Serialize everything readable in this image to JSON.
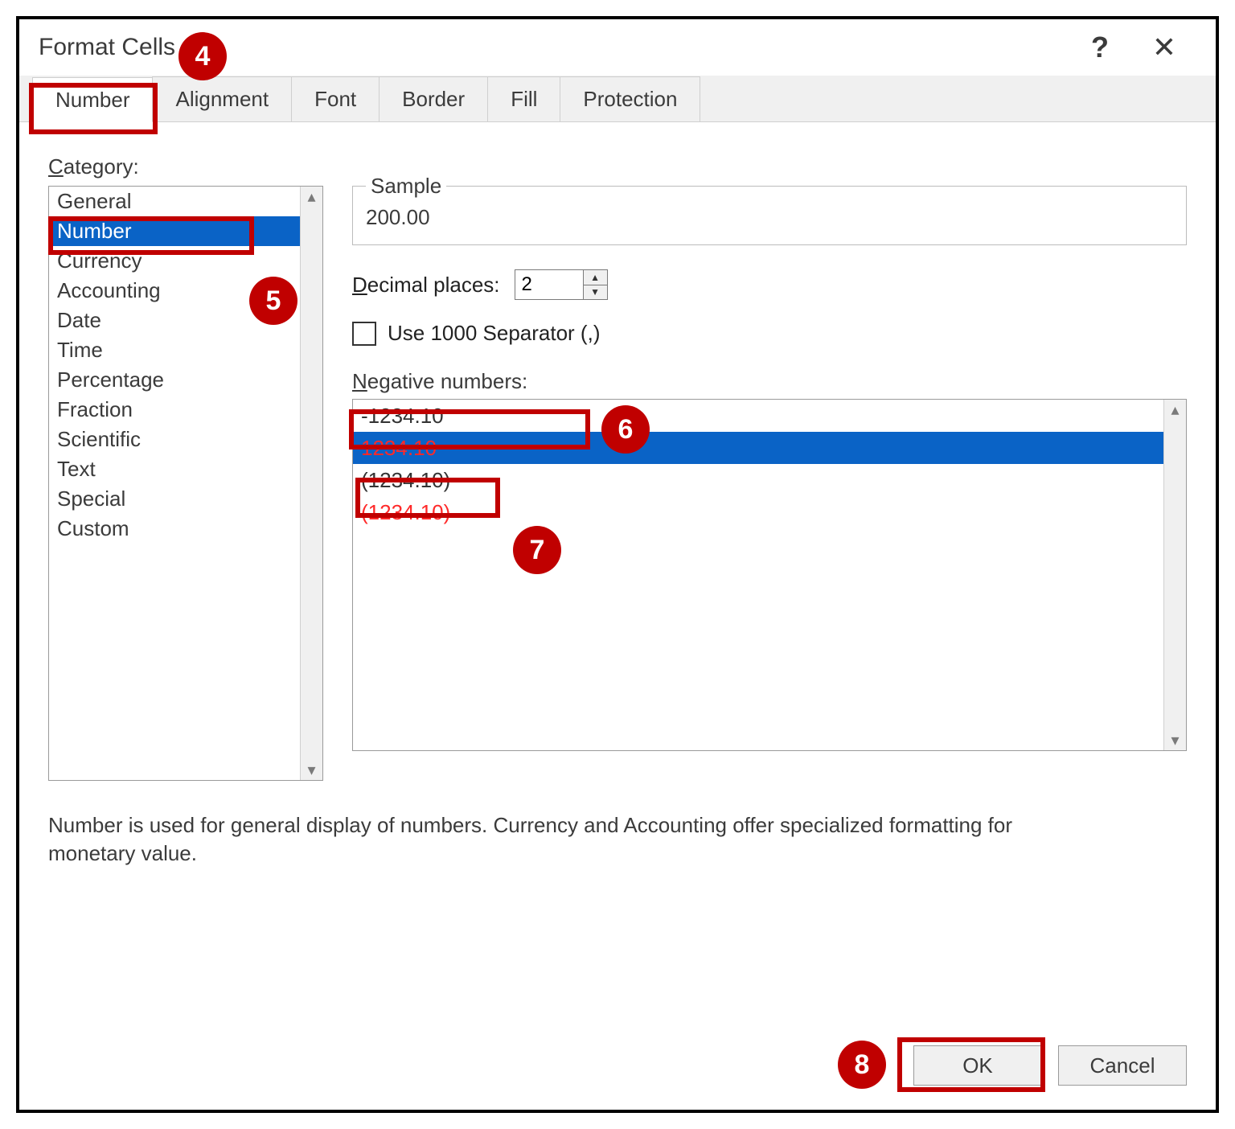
{
  "dialog": {
    "title": "Format Cells",
    "tabs": [
      "Number",
      "Alignment",
      "Font",
      "Border",
      "Fill",
      "Protection"
    ],
    "active_tab_index": 0,
    "category_label": "Category:",
    "categories": [
      "General",
      "Number",
      "Currency",
      "Accounting",
      "Date",
      "Time",
      "Percentage",
      "Fraction",
      "Scientific",
      "Text",
      "Special",
      "Custom"
    ],
    "category_selected_index": 1,
    "sample": {
      "caption": "Sample",
      "value": "200.00"
    },
    "decimal_places_label": "Decimal places:",
    "decimal_places_value": "2",
    "use_separator_label": "Use 1000 Separator (,)",
    "use_separator_checked": false,
    "negative_label": "Negative numbers:",
    "negative_options": [
      {
        "text": "-1234.10",
        "color": "#333333"
      },
      {
        "text": "1234.10",
        "color": "#ff2a2a"
      },
      {
        "text": "(1234.10)",
        "color": "#333333"
      },
      {
        "text": "(1234.10)",
        "color": "#ff2a2a"
      }
    ],
    "negative_selected_index": 1,
    "description": "Number is used for general display of numbers.  Currency and Accounting offer specialized formatting for monetary value.",
    "ok_label": "OK",
    "cancel_label": "Cancel"
  },
  "annotations": {
    "4": "4",
    "5": "5",
    "6": "6",
    "7": "7",
    "8": "8"
  }
}
